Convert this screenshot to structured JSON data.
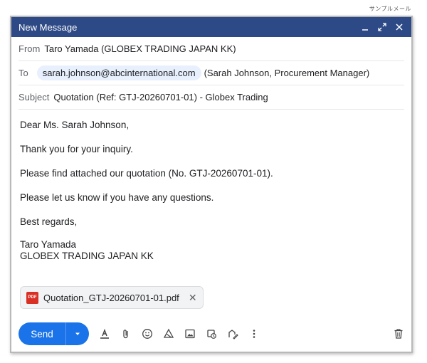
{
  "corner_label": "サンプルメール",
  "window": {
    "title": "New Message"
  },
  "from": {
    "label": "From",
    "value": "Taro Yamada (GLOBEX TRADING JAPAN KK)"
  },
  "to": {
    "label": "To",
    "email": "sarah.johnson@abcinternational.com",
    "name": "(Sarah Johnson, Procurement Manager)"
  },
  "subject": {
    "label": "Subject",
    "value": "Quotation (Ref: GTJ-20260701-01) - Globex Trading"
  },
  "body": {
    "greeting": "Dear Ms. Sarah Johnson,",
    "line1": "Thank you for your inquiry.",
    "line2": "Please find attached our quotation (No. GTJ-20260701-01).",
    "line3": "Please let us know if you have any questions.",
    "closing": "Best regards,",
    "sig_name": "Taro Yamada",
    "sig_company": "GLOBEX TRADING JAPAN KK"
  },
  "attachment": {
    "badge": "PDF",
    "filename": "Quotation_GTJ-20260701-01.pdf"
  },
  "toolbar": {
    "send_label": "Send"
  },
  "colors": {
    "titlebar": "#2e4a86",
    "send": "#1a73e8",
    "chip": "#e8f0fe",
    "pdf": "#d93025"
  }
}
